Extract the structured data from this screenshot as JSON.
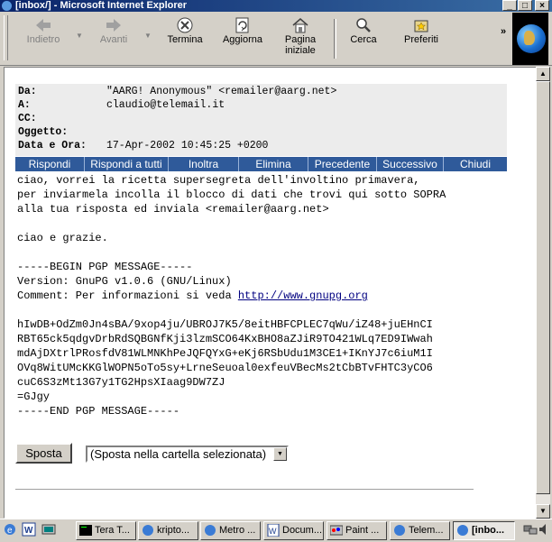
{
  "window": {
    "title": "[inbox/] - Microsoft Internet Explorer"
  },
  "toolbar": {
    "back": "Indietro",
    "forward": "Avanti",
    "stop": "Termina",
    "refresh": "Aggiorna",
    "home": "Pagina iniziale",
    "search": "Cerca",
    "favorites": "Preferiti",
    "more": "»"
  },
  "header": {
    "from_label": "Da:",
    "from_value": "\"AARG! Anonymous\" <remailer@aarg.net>",
    "to_label": "A:",
    "to_value": "claudio@telemail.it",
    "cc_label": "CC:",
    "cc_value": "",
    "subject_label": "Oggetto:",
    "subject_value": "",
    "date_label": "Data e Ora:",
    "date_value": "17-Apr-2002 10:45:25 +0200"
  },
  "actions": [
    "Rispondi",
    "Rispondi a tutti",
    "Inoltra",
    "Elimina",
    "Precedente",
    "Successivo",
    "Chiudi"
  ],
  "message": {
    "intro": "ciao, vorrei la ricetta supersegreta dell'involtino primavera,\nper inviarmela incolla il blocco di dati che trovi qui sotto SOPRA\nalla tua risposta ed inviala <remailer@aarg.net>\n\nciao e grazie.\n\n-----BEGIN PGP MESSAGE-----\nVersion: GnuPG v1.0.6 (GNU/Linux)\nComment: Per informazioni si veda ",
    "link": "http://www.gnupg.org",
    "pgp": "\n\nhIwDB+OdZm0Jn4sBA/9xop4ju/UBROJ7K5/8eitHBFCPLEC7qWu/iZ48+juEHnCI\nRBT65ck5qdgvDrbRdSQBGNfKji3lzmSCO64KxBHO8aZJiR9TO421WLq7ED9IWwah\nmdAjDXtrlPRosfdV81WLMNKhPeJQFQYxG+eKj6RSbUdu1M3CE1+IKnYJ7c6iuM1I\nOVq8WitUMcKKGlWOPN5oTo5sy+LrneSeuoal0exfeuVBecMs2tCbBTvFHTC3yCO6\ncuC6S3zMt13G7y1TG2HpsXIaag9DW7ZJ\n=GJgy\n-----END PGP MESSAGE-----"
  },
  "move": {
    "button": "Sposta",
    "folder": "(Sposta nella cartella selezionata)"
  },
  "taskbar": {
    "tasks": [
      "Tera T...",
      "kripto...",
      "Metro ...",
      "Docum...",
      "Paint ...",
      "Telem...",
      "[inbo..."
    ]
  }
}
